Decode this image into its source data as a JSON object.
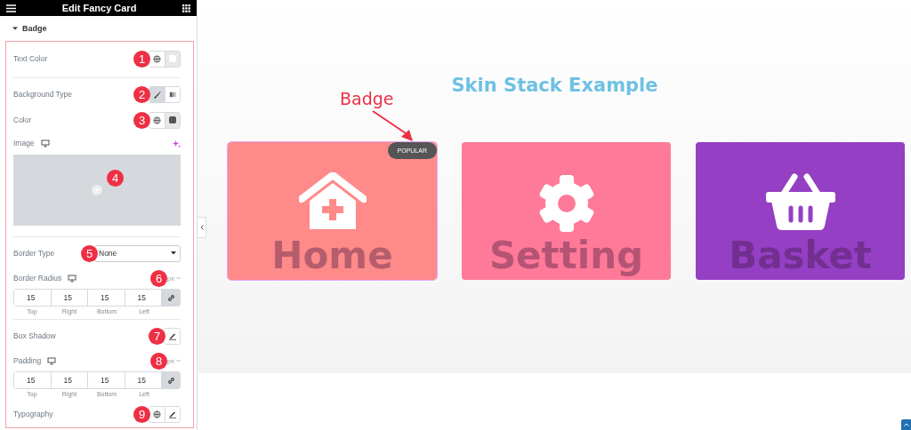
{
  "panel": {
    "title": "Edit Fancy Card",
    "section": {
      "label": "Badge",
      "expanded": true
    },
    "groups": [
      [
        {
          "kind": "color",
          "label": "Text Color",
          "color": "#ffffff",
          "callout": "1"
        }
      ],
      [
        {
          "kind": "choice",
          "label": "Background Type",
          "callout": "2",
          "options": [
            {
              "selected": true
            },
            {
              "selected": false
            }
          ]
        },
        {
          "kind": "color",
          "label": "Color",
          "color": "#555555",
          "callout": "3"
        },
        {
          "kind": "image",
          "label": "Image",
          "callout": "4"
        }
      ],
      [
        {
          "kind": "select",
          "label": "Border Type",
          "value": "None",
          "callout": "5"
        },
        {
          "kind": "dimensions",
          "label": "Border Radius",
          "unit": "px",
          "callout": "6",
          "linked": true,
          "fields": [
            {
              "value": "15",
              "label": "Top"
            },
            {
              "value": "15",
              "label": "Right"
            },
            {
              "value": "15",
              "label": "Bottom"
            },
            {
              "value": "15",
              "label": "Left"
            }
          ]
        }
      ],
      [
        {
          "kind": "popover",
          "label": "Box Shadow",
          "callout": "7"
        },
        {
          "kind": "dimensions",
          "label": "Padding",
          "unit": "px",
          "callout": "8",
          "linked": true,
          "fields": [
            {
              "value": "15",
              "label": "Top"
            },
            {
              "value": "15",
              "label": "Right"
            },
            {
              "value": "15",
              "label": "Bottom"
            },
            {
              "value": "15",
              "label": "Left"
            }
          ]
        },
        {
          "kind": "typography",
          "label": "Typography",
          "callout": "9"
        }
      ]
    ]
  },
  "canvas": {
    "heading": "Skin Stack Example",
    "annotation": {
      "label": "Badge"
    },
    "cards": [
      {
        "title": "Home",
        "color": "#ff8a8a",
        "badge": "POPULAR",
        "selected": true
      },
      {
        "title": "Setting",
        "color": "#ff7a98",
        "selected": false
      },
      {
        "title": "Basket",
        "color": "#943fc4",
        "selected": false
      }
    ]
  }
}
